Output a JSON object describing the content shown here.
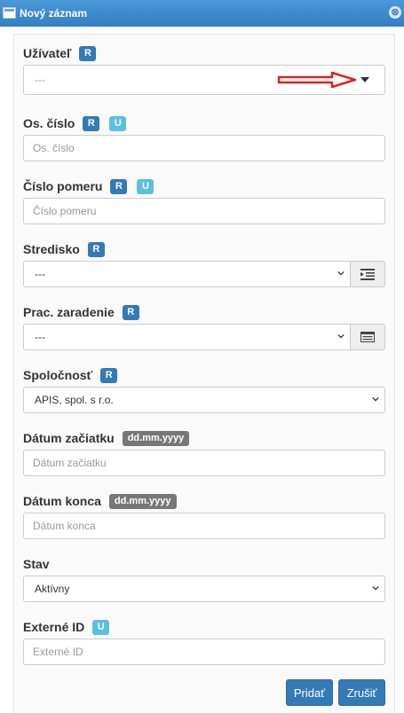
{
  "window": {
    "title": "Nový záznam",
    "close_glyph": "⊗"
  },
  "badges": {
    "required": "R",
    "unique": "U",
    "date_format": "dd.mm.yyyy"
  },
  "fields": {
    "user": {
      "label": "Užívateľ",
      "value": "---"
    },
    "emp_number": {
      "label": "Os. číslo",
      "placeholder": "Os. číslo"
    },
    "contract_number": {
      "label": "Číslo pomeru",
      "placeholder": "Číslo pomeru"
    },
    "cost_center": {
      "label": "Stredisko",
      "value": "---"
    },
    "job_position": {
      "label": "Prac. zaradenie",
      "value": "---"
    },
    "company": {
      "label": "Spoločnosť",
      "value": "APIS, spol. s r.o."
    },
    "start_date": {
      "label": "Dátum začiatku",
      "placeholder": "Dátum začiatku"
    },
    "end_date": {
      "label": "Dátum konca",
      "placeholder": "Dátum konca"
    },
    "status": {
      "label": "Stav",
      "value": "Aktívny"
    },
    "external_id": {
      "label": "Externé ID",
      "placeholder": "Externé ID"
    }
  },
  "buttons": {
    "add": "Pridať",
    "cancel": "Zrušiť"
  },
  "colors": {
    "titlebar": "#337fc2",
    "primary": "#337ab7",
    "info": "#5bc0de",
    "annotation_arrow": "#e02020"
  }
}
